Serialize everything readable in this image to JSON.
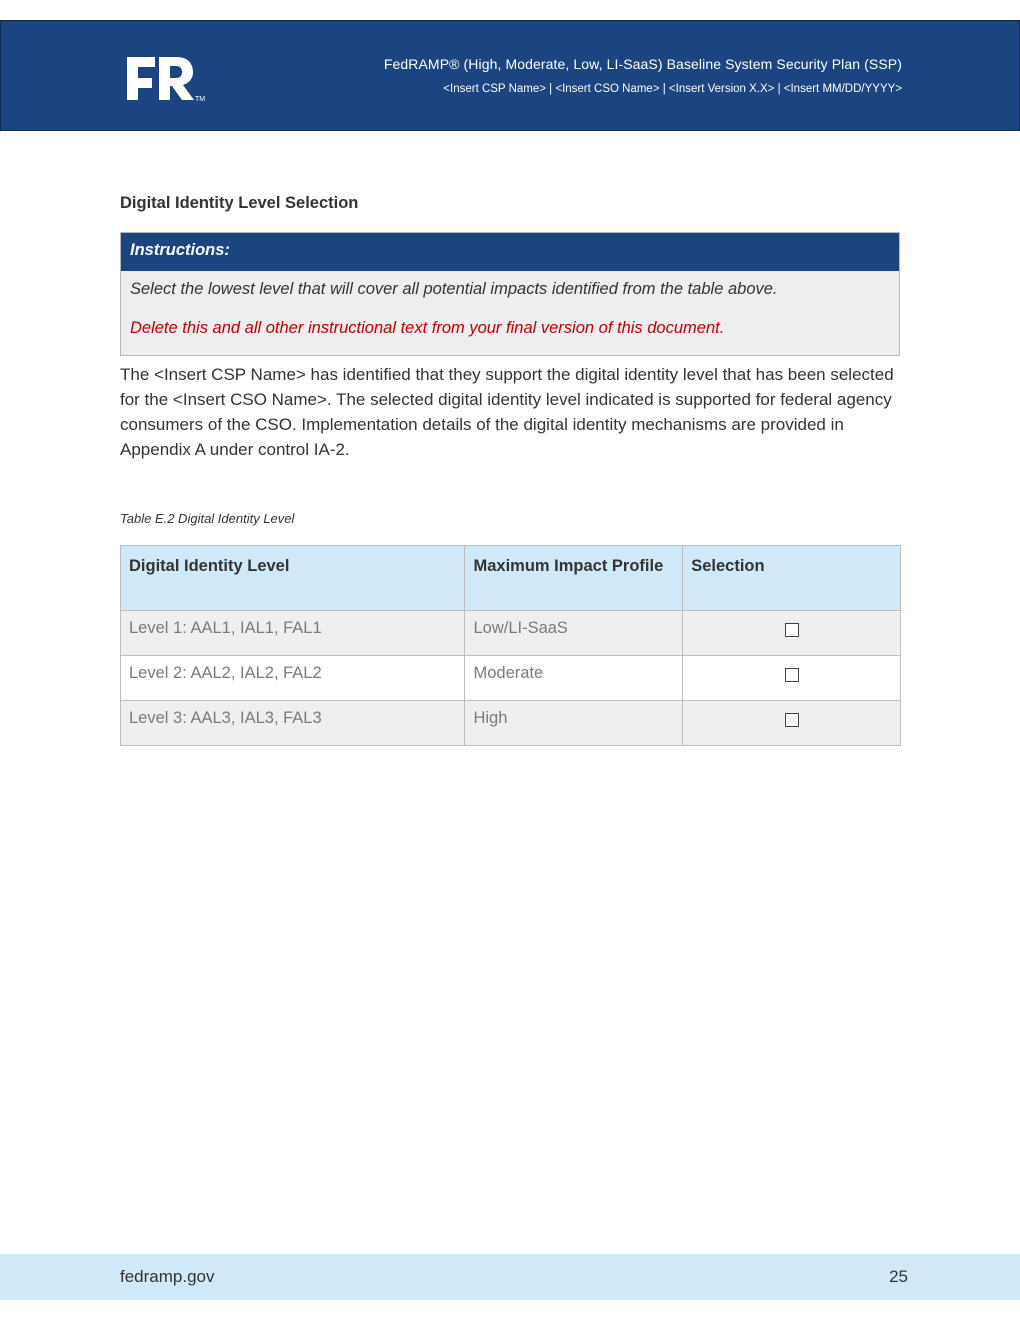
{
  "header": {
    "logo_text": "FR",
    "logo_tm": "TM",
    "title": "FedRAMP® (High, Moderate, Low, LI-SaaS) Baseline System Security Plan (SSP)",
    "subtitle": "<Insert CSP Name> | <Insert CSO Name> | <Insert Version X.X> | <Insert MM/DD/YYYY>"
  },
  "section": {
    "heading": "Digital Identity Level Selection"
  },
  "instructions": {
    "label": "Instructions:",
    "line1": "Select the lowest level that will cover all potential impacts identified from the table above.",
    "line2": "Delete this and all other instructional text from your final version of this document."
  },
  "body": {
    "paragraph": "The <Insert CSP Name> has identified that they support the digital identity level that has been selected for the <Insert CSO Name>. The selected digital identity level indicated is supported for federal agency consumers of the CSO. Implementation details of the digital identity mechanisms are provided in Appendix A under control IA-2."
  },
  "table": {
    "caption": "Table E.2 Digital Identity Level",
    "headers": [
      "Digital Identity Level",
      "Maximum Impact Profile",
      "Selection"
    ],
    "rows": [
      {
        "level": "Level 1: AAL1, IAL1, FAL1",
        "profile": "Low/LI-SaaS",
        "checkbox": "☐"
      },
      {
        "level": "Level 2: AAL2, IAL2, FAL2",
        "profile": "Moderate",
        "checkbox": "☐"
      },
      {
        "level": "Level 3: AAL3, IAL3, FAL3",
        "profile": "High",
        "checkbox": "☐"
      }
    ]
  },
  "footer": {
    "site": "fedramp.gov",
    "page_number": "25"
  },
  "colors": {
    "brand_navy": "#1b4480",
    "header_light_blue": "#cfe9f8",
    "instruction_red": "#c00000"
  }
}
